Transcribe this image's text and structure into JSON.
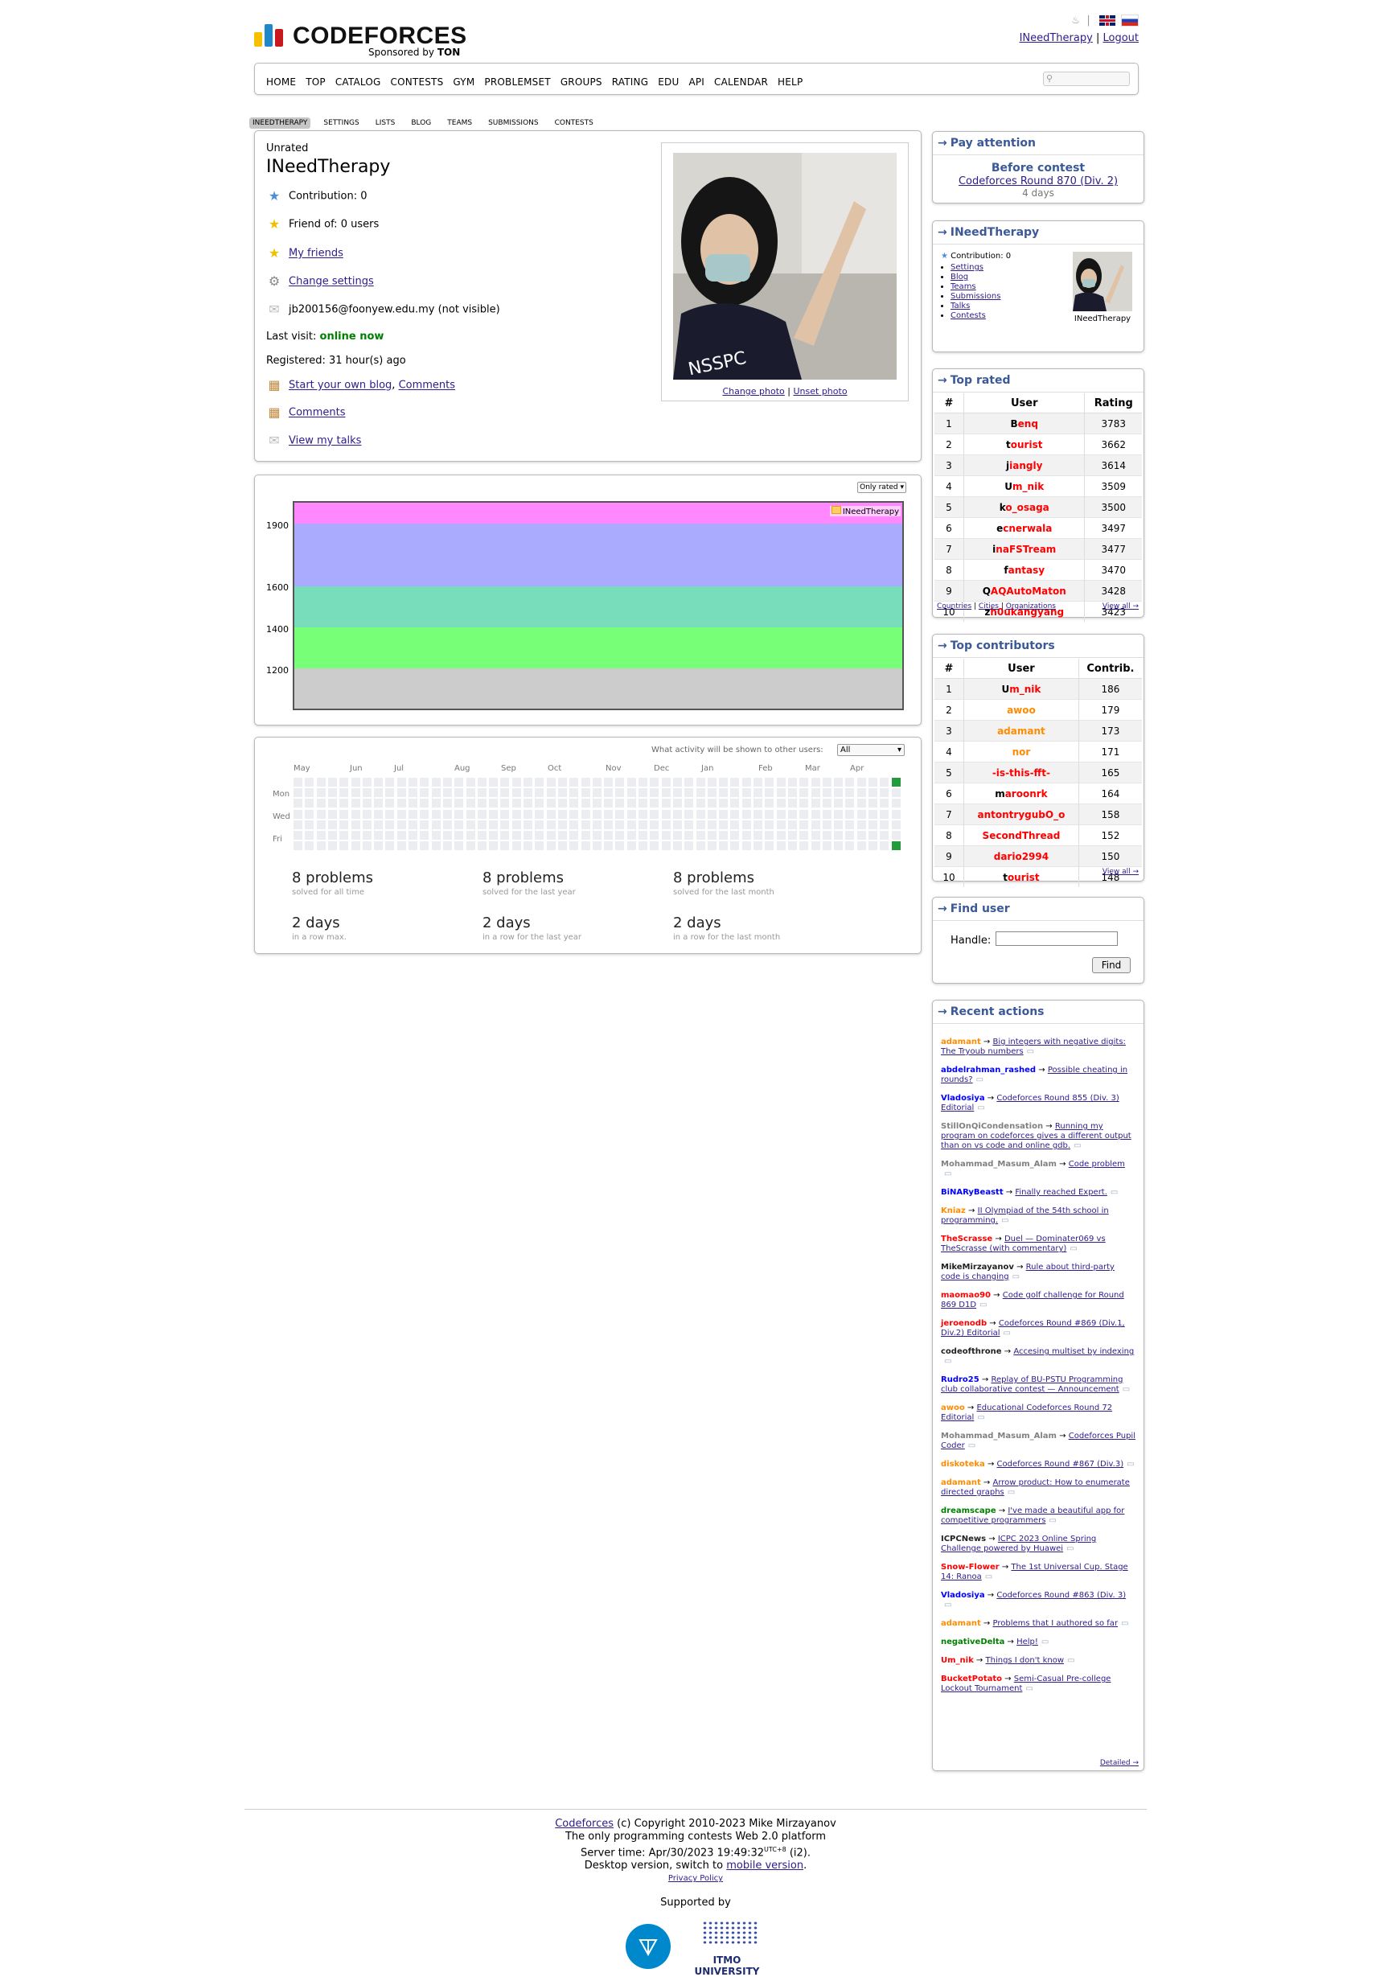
{
  "header": {
    "logo_text": "CODEFORCES",
    "sponsored_prefix": "Sponsored by",
    "sponsor": "TON",
    "user_link": "INeedTherapy",
    "separator": "|",
    "logout": "Logout"
  },
  "menu": [
    "HOME",
    "TOP",
    "CATALOG",
    "CONTESTS",
    "GYM",
    "PROBLEMSET",
    "GROUPS",
    "RATING",
    "EDU",
    "API",
    "CALENDAR",
    "HELP"
  ],
  "submenu": [
    "INEEDTHERAPY",
    "SETTINGS",
    "LISTS",
    "BLOG",
    "TEAMS",
    "SUBMISSIONS",
    "CONTESTS"
  ],
  "profile": {
    "rank": "Unrated",
    "handle": "INeedTherapy",
    "contribution_label": "Contribution:",
    "contribution": "0",
    "friend_of": "Friend of: 0 users",
    "my_friends": "My friends",
    "change_settings": "Change settings",
    "email": "jb200156@foonyew.edu.my (not visible)",
    "last_visit_label": "Last visit:",
    "last_visit": "online now",
    "registered": "Registered: 31 hour(s) ago",
    "start_blog": "Start your own blog",
    "comma": ",",
    "comments_link": "Comments",
    "comments": "Comments",
    "view_talks": "View my talks",
    "change_photo": "Change photo",
    "unset_photo": "Unset photo",
    "photo_text": "NSSPC"
  },
  "rating_graph": {
    "selector": "Only rated",
    "legend": "INeedTherapy",
    "y_ticks": [
      "1900",
      "1600",
      "1400",
      "1200"
    ]
  },
  "activity": {
    "visibility_label": "What activity will be shown to other users:",
    "visibility_value": "All",
    "months": [
      "May",
      "Jun",
      "Jul",
      "Aug",
      "Sep",
      "Oct",
      "Nov",
      "Dec",
      "Jan",
      "Feb",
      "Mar",
      "Apr"
    ],
    "days": [
      "Mon",
      "Wed",
      "Fri"
    ],
    "stats": [
      {
        "value": "8 problems",
        "label": "solved for all time"
      },
      {
        "value": "8 problems",
        "label": "solved for the last year"
      },
      {
        "value": "8 problems",
        "label": "solved for the last month"
      },
      {
        "value": "2 days",
        "label": "in a row max."
      },
      {
        "value": "2 days",
        "label": "in a row for the last year"
      },
      {
        "value": "2 days",
        "label": "in a row for the last month"
      }
    ],
    "colors": {
      "empty": "#ebedf0",
      "active": "#239a3b"
    }
  },
  "sidebar": {
    "pay_attention": {
      "title": "Pay attention",
      "before": "Before contest",
      "contest": "Codeforces Round 870 (Div. 2)",
      "when": "4 days"
    },
    "me": {
      "title": "INeedTherapy",
      "contribution": "Contribution: 0",
      "links": [
        "Settings",
        "Blog",
        "Teams",
        "Submissions",
        "Talks",
        "Contests"
      ],
      "name": "INeedTherapy"
    },
    "top_rated": {
      "title": "Top rated",
      "headers": [
        "#",
        "User",
        "Rating"
      ],
      "rows": [
        {
          "n": "1",
          "user": "Benq",
          "v": "3783",
          "color": "legend"
        },
        {
          "n": "2",
          "user": "tourist",
          "v": "3662",
          "color": "legend"
        },
        {
          "n": "3",
          "user": "jiangly",
          "v": "3614",
          "color": "legend"
        },
        {
          "n": "4",
          "user": "Um_nik",
          "v": "3509",
          "color": "legend"
        },
        {
          "n": "5",
          "user": "ko_osaga",
          "v": "3500",
          "color": "legend"
        },
        {
          "n": "6",
          "user": "ecnerwala",
          "v": "3497",
          "color": "legend"
        },
        {
          "n": "7",
          "user": "inaFSTream",
          "v": "3477",
          "color": "legend"
        },
        {
          "n": "8",
          "user": "fantasy",
          "v": "3470",
          "color": "legend"
        },
        {
          "n": "9",
          "user": "QAQAutoMaton",
          "v": "3428",
          "color": "legend"
        },
        {
          "n": "10",
          "user": "zh0ukangyang",
          "v": "3423",
          "color": "legend"
        }
      ],
      "links": [
        "Countries",
        "Cities",
        "Organizations"
      ],
      "view_all": "View all →"
    },
    "top_contributors": {
      "title": "Top contributors",
      "headers": [
        "#",
        "User",
        "Contrib."
      ],
      "rows": [
        {
          "n": "1",
          "user": "Um_nik",
          "v": "186",
          "color": "legend"
        },
        {
          "n": "2",
          "user": "awoo",
          "v": "179",
          "color": "orange"
        },
        {
          "n": "3",
          "user": "adamant",
          "v": "173",
          "color": "orange"
        },
        {
          "n": "4",
          "user": "nor",
          "v": "171",
          "color": "orange"
        },
        {
          "n": "5",
          "user": "-is-this-fft-",
          "v": "165",
          "color": "red"
        },
        {
          "n": "6",
          "user": "maroonrk",
          "v": "164",
          "color": "legend"
        },
        {
          "n": "7",
          "user": "antontrygubO_o",
          "v": "158",
          "color": "red"
        },
        {
          "n": "8",
          "user": "SecondThread",
          "v": "152",
          "color": "red"
        },
        {
          "n": "9",
          "user": "dario2994",
          "v": "150",
          "color": "red"
        },
        {
          "n": "10",
          "user": "tourist",
          "v": "148",
          "color": "legend"
        }
      ],
      "view_all": "View all →"
    },
    "find_user": {
      "title": "Find user",
      "handle_label": "Handle:",
      "button": "Find"
    },
    "recent": {
      "title": "Recent actions",
      "items": [
        {
          "user": "adamant",
          "color": "orange",
          "text": "Big integers with negative digits: The Tryoub numbers"
        },
        {
          "user": "abdelrahman_rashed",
          "color": "blue",
          "text": "Possible cheating in rounds?"
        },
        {
          "user": "Vladosiya",
          "color": "blue",
          "text": "Codeforces Round 855 (Div. 3) Editorial"
        },
        {
          "user": "StillOnQiCondensation",
          "color": "gray",
          "text": "Running my program on codeforces gives a different output than on vs code and online gdb."
        },
        {
          "user": "Mohammad_Masum_Alam",
          "color": "gray",
          "text": "Code problem"
        },
        {
          "user": "BiNARyBeastt",
          "color": "blue",
          "text": "Finally reached Expert."
        },
        {
          "user": "Kniaz",
          "color": "orange",
          "text": "II Olympiad of the 54th school in programming."
        },
        {
          "user": "TheScrasse",
          "color": "red",
          "text": "Duel — Dominater069 vs TheScrasse (with commentary)"
        },
        {
          "user": "MikeMirzayanov",
          "color": "black",
          "text": "Rule about third-party code is changing"
        },
        {
          "user": "maomao90",
          "color": "red",
          "text": "Code golf challenge for Round 869 D1D"
        },
        {
          "user": "jeroenodb",
          "color": "red",
          "text": "Codeforces Round #869 (Div.1, Div.2) Editorial"
        },
        {
          "user": "codeofthrone",
          "color": "black",
          "text": "Accesing multiset by indexing"
        },
        {
          "user": "Rudro25",
          "color": "blue",
          "text": "Replay of BU-PSTU Programming club collaborative contest — Announcement"
        },
        {
          "user": "awoo",
          "color": "orange",
          "text": "Educational Codeforces Round 72 Editorial"
        },
        {
          "user": "Mohammad_Masum_Alam",
          "color": "gray",
          "text": "Codeforces Pupil Coder"
        },
        {
          "user": "diskoteka",
          "color": "orange",
          "text": "Codeforces Round #867 (Div.3)"
        },
        {
          "user": "adamant",
          "color": "orange",
          "text": "Arrow product: How to enumerate directed graphs"
        },
        {
          "user": "dreamscape",
          "color": "green",
          "text": "I've made a beautiful app for competitive programmers"
        },
        {
          "user": "ICPCNews",
          "color": "black",
          "text": "ICPC 2023 Online Spring Challenge powered by Huawei"
        },
        {
          "user": "Snow-Flower",
          "color": "red",
          "text": "The 1st Universal Cup. Stage 14: Ranoa"
        },
        {
          "user": "Vladosiya",
          "color": "blue",
          "text": "Codeforces Round #863 (Div. 3)"
        },
        {
          "user": "adamant",
          "color": "orange",
          "text": "Problems that I authored so far"
        },
        {
          "user": "negativeDelta",
          "color": "green",
          "text": "Help!"
        },
        {
          "user": "Um_nik",
          "color": "red",
          "text": "Things I don't know"
        },
        {
          "user": "BucketPotato",
          "color": "red",
          "text": "Semi-Casual Pre-college Lockout Tournament"
        }
      ],
      "detailed": "Detailed →"
    }
  },
  "footer": {
    "codeforces": "Codeforces",
    "copyright": " (c) Copyright 2010-2023 Mike Mirzayanov",
    "tagline": "The only programming contests Web 2.0 platform",
    "server_time": "Server time: Apr/30/2023 19:49:32",
    "utc": "UTC+8",
    "server_tail": " (i2).",
    "desktop": "Desktop version, switch to ",
    "mobile": "mobile version",
    "period": ".",
    "privacy": "Privacy Policy",
    "supported_by": "Supported by",
    "itmo": "ITMO UNIVERSITY"
  }
}
